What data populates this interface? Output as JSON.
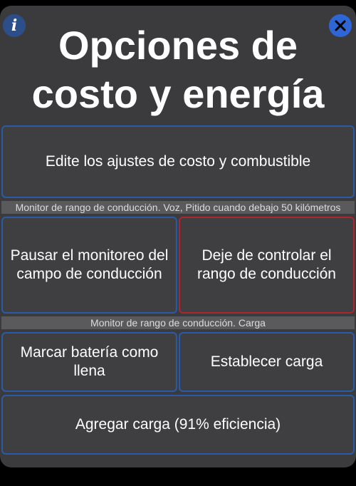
{
  "header": {
    "title": "Opciones de costo y energía",
    "info_glyph": "i",
    "info_icon": "info-icon",
    "close_icon": "close-icon"
  },
  "buttons": {
    "edit_cost_fuel": "Edite los ajustes de costo y combustible",
    "pause_monitoring": "Pausar el monitoreo del campo de conducción",
    "stop_range_control": "Deje de controlar el rango de conducción",
    "mark_battery_full": "Marcar batería como llena",
    "set_charge": "Establecer carga",
    "add_charge": "Agregar carga (91% eficiencia)"
  },
  "sections": {
    "range_monitor_voice": "Monitor de rango de conducción. Voz, Pitido cuando debajo 50 kilómetros",
    "range_monitor_charge": "Monitor de rango de conducción. Carga"
  },
  "colors": {
    "panel_bg": "#3b3b3d",
    "button_border_blue": "#2a5ba8",
    "button_border_red": "#b0262e",
    "close_button_bg": "#2f66d6",
    "info_button_bg": "#2c4f8a"
  }
}
